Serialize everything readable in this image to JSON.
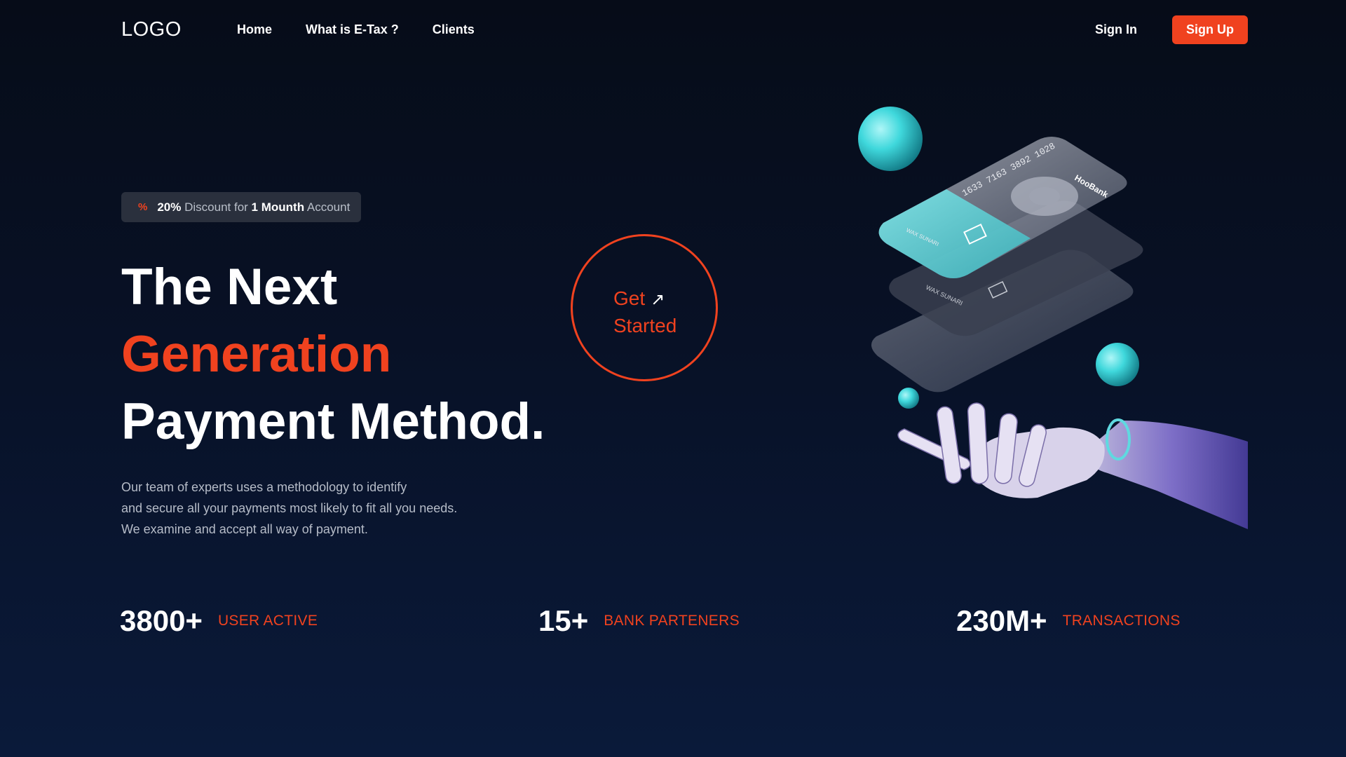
{
  "nav": {
    "logo": "LOGO",
    "links": [
      "Home",
      "What is E-Tax ?",
      "Clients"
    ],
    "sign_in": "Sign In",
    "sign_up": "Sign Up"
  },
  "badge": {
    "icon": "percent-icon",
    "percent": "20%",
    "text1": "Discount for",
    "bold": "1 Mounth",
    "text2": "Account"
  },
  "hero": {
    "line1": "The Next",
    "line2": "Generation",
    "line3": "Payment Method.",
    "desc": [
      "Our team of experts uses a methodology to identify",
      "and secure all your payments most likely to fit all you needs.",
      "We examine and accept all way of payment."
    ]
  },
  "cta": {
    "line1": "Get",
    "line2": "Started",
    "icon": "arrow-up-right-icon"
  },
  "stats": [
    {
      "number": "3800+",
      "label": "USER ACTIVE"
    },
    {
      "number": "15+",
      "label": "BANK PARTENERS"
    },
    {
      "number": "230M+",
      "label": "TRANSACTIONS"
    }
  ],
  "illustration": {
    "card_number": "1633 7163 3892 1028",
    "brand": "HooBank",
    "cardholder": "WAX SUNARI"
  },
  "colors": {
    "accent": "#f0421f",
    "background": "#081126",
    "sphere": "#3fd8dc"
  }
}
